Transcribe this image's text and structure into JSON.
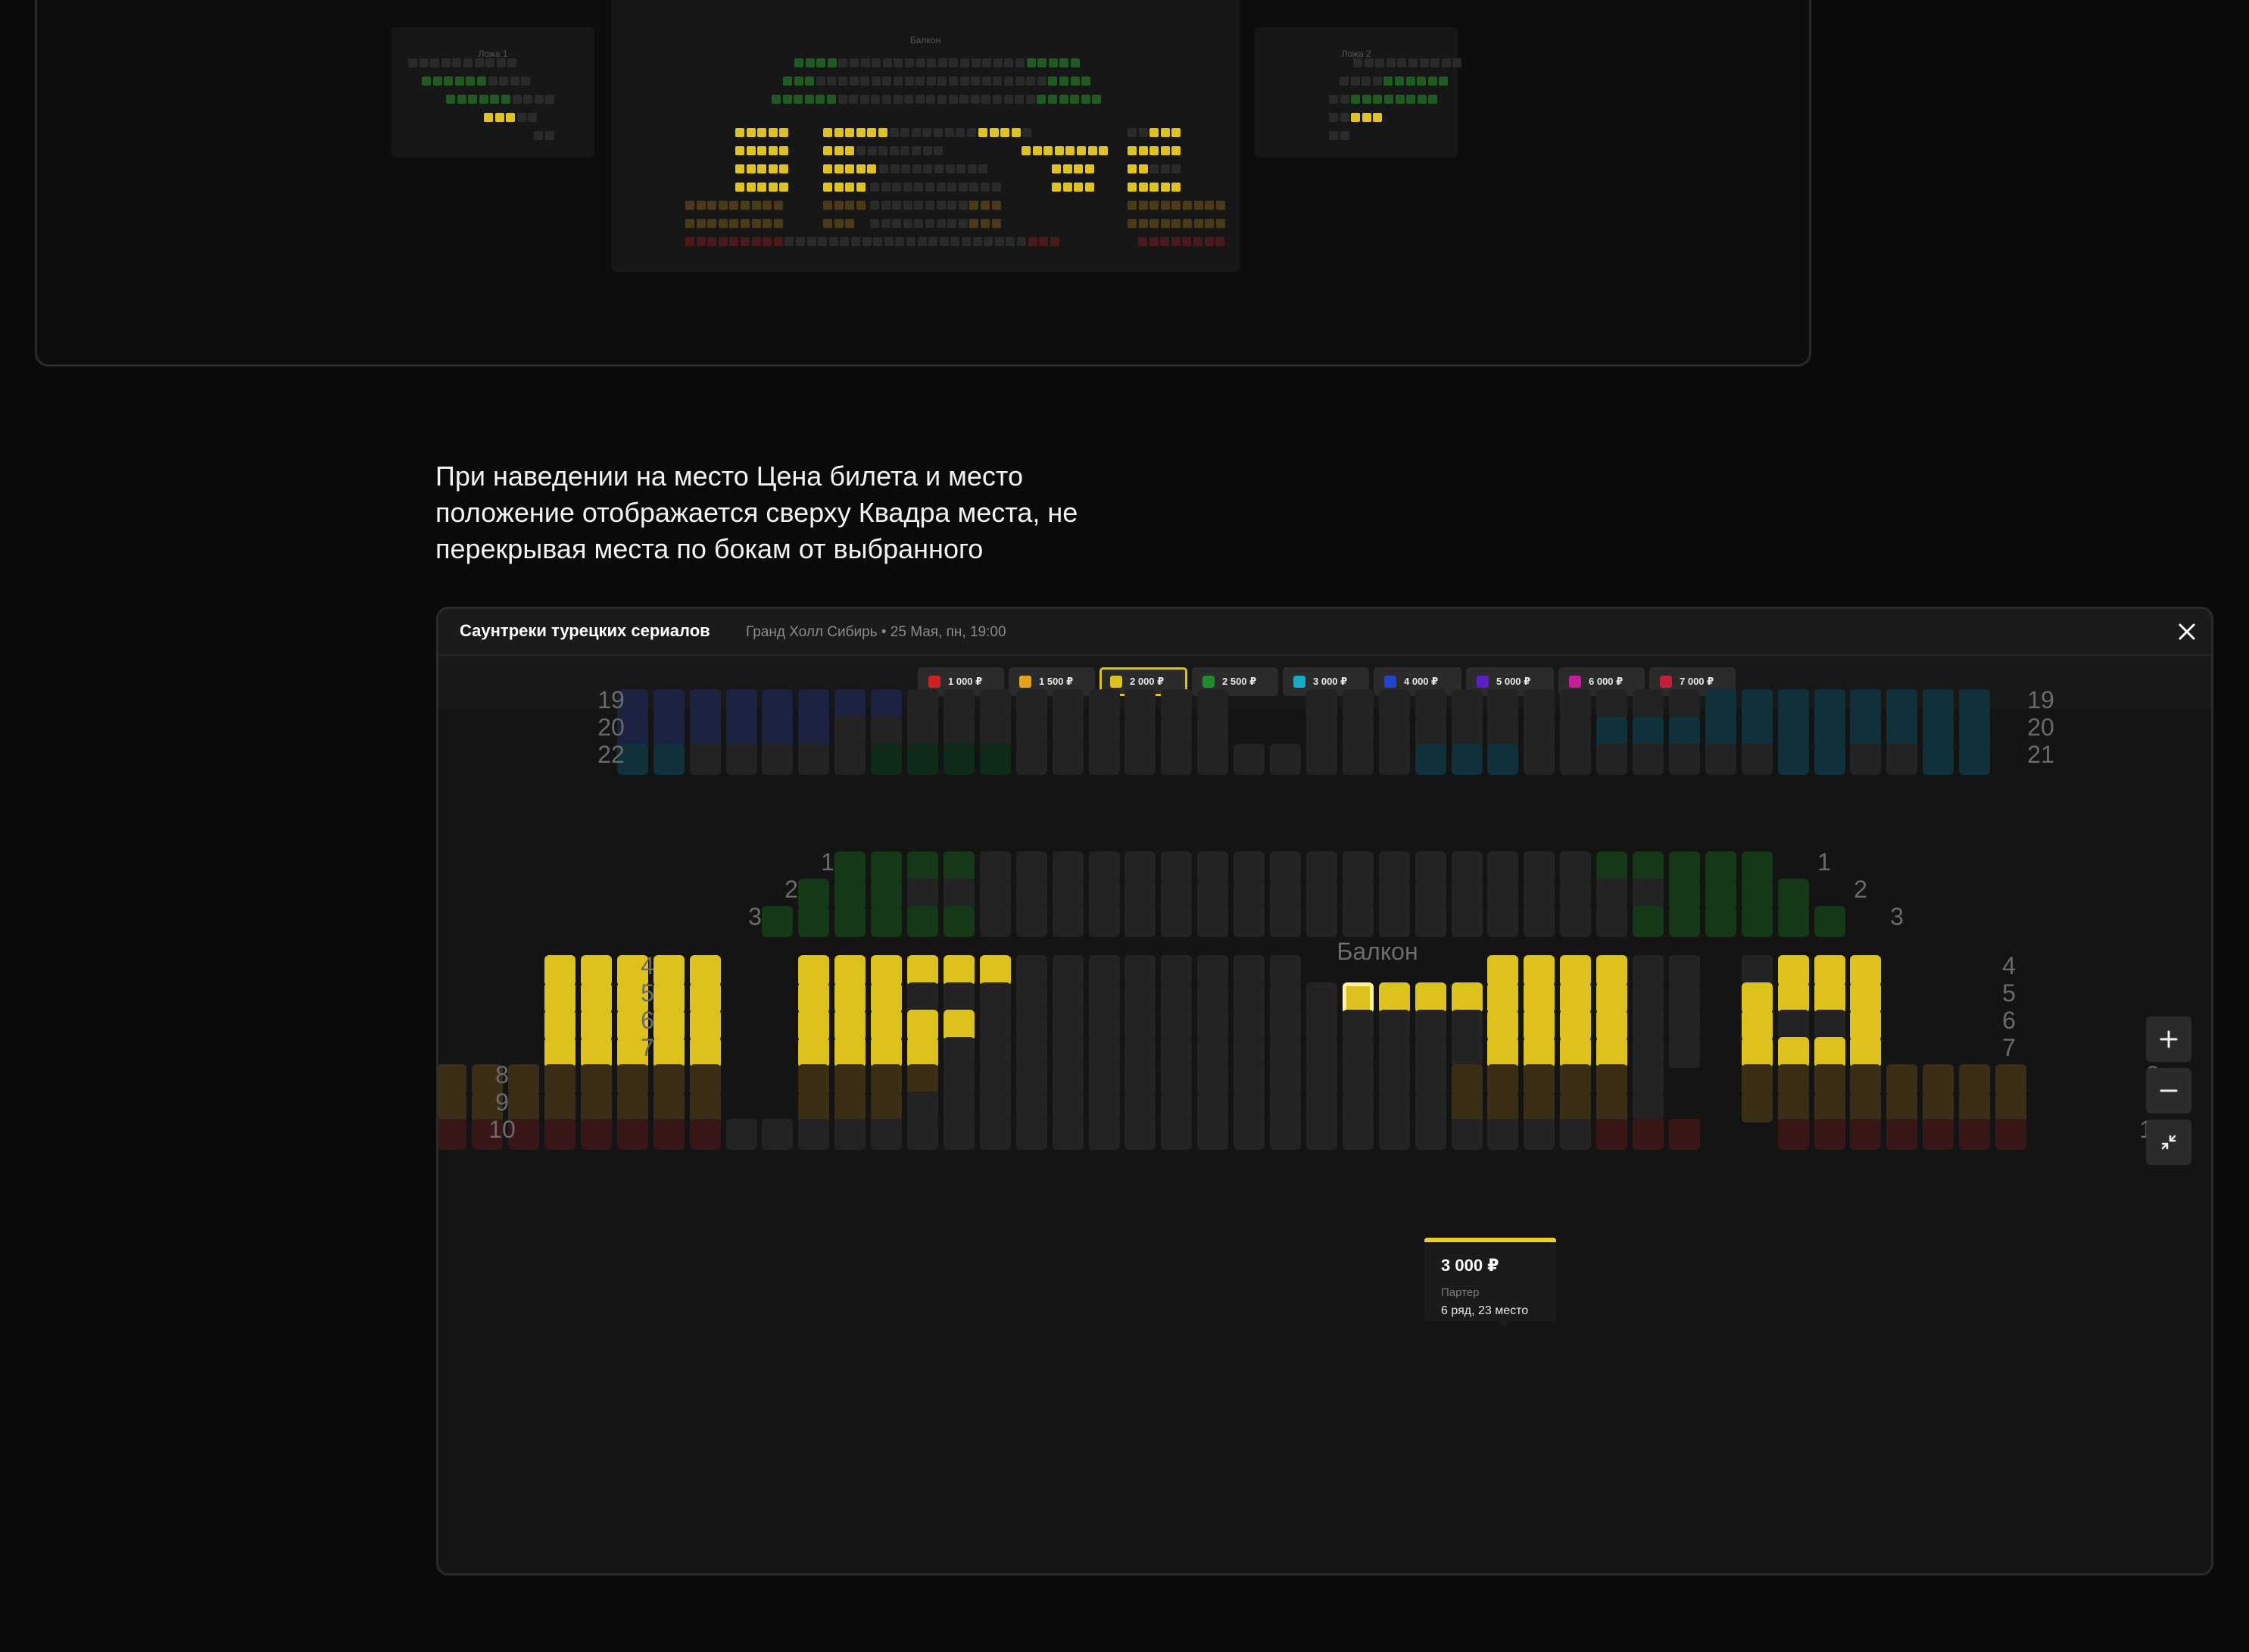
{
  "colors": {
    "background": "#0a0a0a",
    "selected_price": "#dcc21e",
    "empty_seat": "#232323"
  },
  "preview": {
    "loge1_title": "Ложа 1",
    "balcony_title": "Балкон",
    "loge2_title": "Ложа 2"
  },
  "note": {
    "line1": "При наведении на место Цена билета и место",
    "line2": "положение отображается сверху Квадра места, не",
    "line3": "перекрывая места по бокам от выбранного"
  },
  "modal": {
    "title": "Саунтреки турецких сериалов",
    "subtitle": "Гранд Холл Сибирь • 25 Мая, пн, 19:00",
    "close_icon": "close-icon"
  },
  "price_legend": [
    {
      "label": "1 000 ₽",
      "color": "#cc2222",
      "selected": false
    },
    {
      "label": "1 500 ₽",
      "color": "#e4a11b",
      "selected": false
    },
    {
      "label": "2 000 ₽",
      "color": "#dcc21e",
      "selected": true
    },
    {
      "label": "2 500 ₽",
      "color": "#1f8a2e",
      "selected": false
    },
    {
      "label": "3 000 ₽",
      "color": "#19a9c4",
      "selected": false
    },
    {
      "label": "4 000 ₽",
      "color": "#2346c9",
      "selected": false
    },
    {
      "label": "5 000 ₽",
      "color": "#5b1fc2",
      "selected": false
    },
    {
      "label": "6 000 ₽",
      "color": "#c41f98",
      "selected": false
    },
    {
      "label": "7 000 ₽",
      "color": "#c41f3a",
      "selected": false
    }
  ],
  "hall": {
    "section_label": "Балкон",
    "upper_rows": [
      {
        "left": "19",
        "right": "19"
      },
      {
        "left": "20",
        "right": "20"
      },
      {
        "left": "22",
        "right": "21"
      }
    ],
    "balcony_rows": [
      "1",
      "2",
      "3"
    ],
    "parterre_rows": [
      "4",
      "5",
      "6",
      "7",
      "8",
      "9",
      "10"
    ]
  },
  "zoom": {
    "plus_icon": "plus-icon",
    "minus_icon": "minus-icon",
    "collapse_icon": "collapse-icon"
  },
  "tooltip": {
    "price": "3 000 ₽",
    "zone": "Партер",
    "place": "6 ряд, 23 место"
  }
}
